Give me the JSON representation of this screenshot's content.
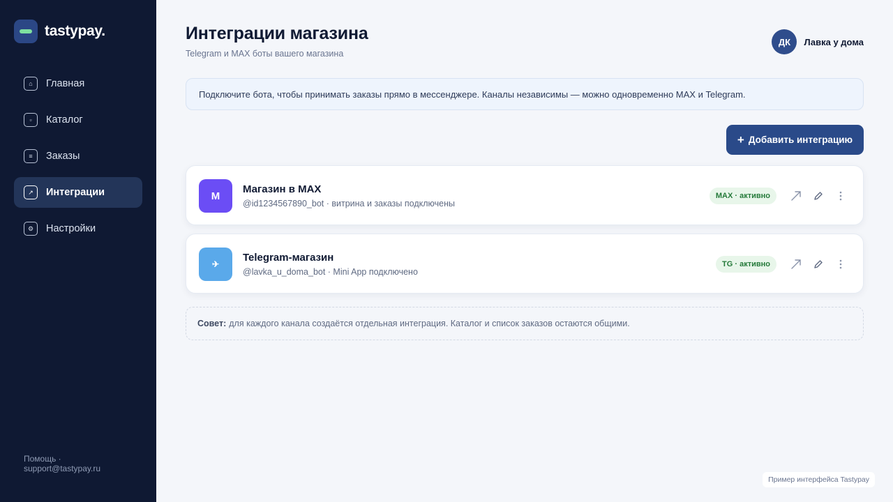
{
  "brand": {
    "name": "tastypay."
  },
  "nav": [
    {
      "label": "Главная",
      "icon": "home-icon",
      "glyph": "⌂",
      "active": false
    },
    {
      "label": "Каталог",
      "icon": "catalog-icon",
      "glyph": "▫",
      "active": false
    },
    {
      "label": "Заказы",
      "icon": "orders-icon",
      "glyph": "≡",
      "active": false
    },
    {
      "label": "Интеграции",
      "icon": "integrations-icon",
      "glyph": "↗",
      "active": true
    },
    {
      "label": "Настройки",
      "icon": "settings-icon",
      "glyph": "⚙",
      "active": false
    }
  ],
  "help": "Помощь · support@tastypay.ru",
  "header": {
    "title": "Интеграции магазина",
    "subtitle": "Telegram и MAX боты вашего магазина",
    "user": {
      "initials": "ДК",
      "name": "Лавка у дома"
    }
  },
  "info": "Подключите бота, чтобы принимать заказы прямо в мессенджере. Каналы независимы — можно одновременно MAX и Telegram.",
  "add_button": {
    "plus": "+",
    "label": "Добавить интеграцию"
  },
  "integrations": [
    {
      "logo_text": "M",
      "logo_color": "#6b4df5",
      "title": "Магазин в MAX",
      "meta": "@id1234567890_bot · витрина и заказы подключены",
      "badge": "MAX · активно"
    },
    {
      "logo_text": "✈",
      "logo_color": "#5aa9ea",
      "title": "Telegram-магазин",
      "meta": "@lavka_u_doma_bot · Mini App подключено",
      "badge": "TG · активно"
    }
  ],
  "tip": {
    "label": "Совет:",
    "text": "для каждого канала создаётся отдельная интеграция. Каталог и список заказов остаются общими."
  },
  "footnote": "Пример интерфейса Tastypay",
  "colors": {
    "sidebar": "#0f1933",
    "accent": "#2a4a89",
    "badge_bg": "#e8f6ea",
    "badge_text": "#257a3a"
  }
}
